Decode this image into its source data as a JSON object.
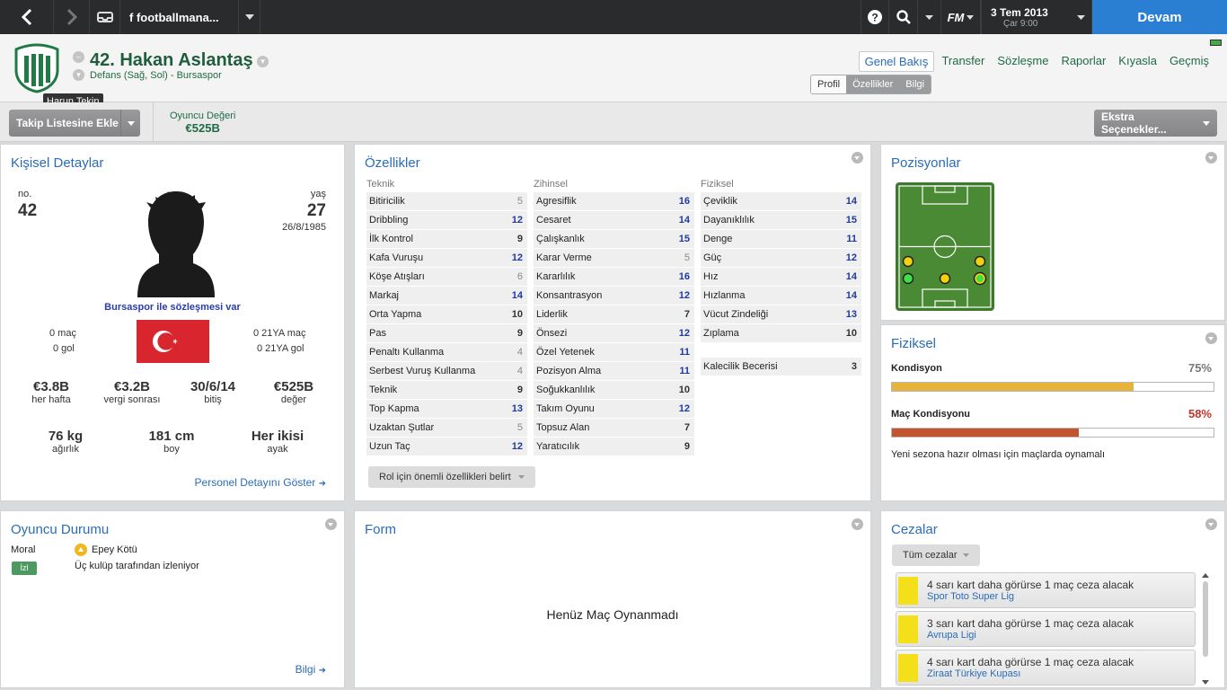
{
  "topbar": {
    "tab_title": "f footballmana...",
    "date": "3 Tem 2013",
    "day_time": "Çar 9:00",
    "fm_label": "FM",
    "continue_label": "Devam"
  },
  "player": {
    "name": "42. Hakan Aslantaş",
    "subtitle": "Defans (Sağ, Sol) - Bursaspor",
    "tooltip": "Harun Tekin"
  },
  "tabs": [
    "Genel Bakış",
    "Transfer",
    "Sözleşme",
    "Raporlar",
    "Kıyasla",
    "Geçmiş"
  ],
  "subtabs": [
    "Profil",
    "Özellikler",
    "Bilgi"
  ],
  "actions": {
    "shortlist": "Takip Listesine Ekle",
    "value_label": "Oyuncu Değeri",
    "value": "€525B",
    "extra": "Ekstra Seçenekler..."
  },
  "personal": {
    "title": "Kişisel Detaylar",
    "no_label": "no.",
    "no": "42",
    "age_label": "yaş",
    "age": "27",
    "dob": "26/8/1985",
    "contract": "Bursaspor ile sözleşmesi var",
    "apps": "0 maç",
    "goals": "0 gol",
    "u21_apps": "0 21YA maç",
    "u21_goals": "0 21YA gol",
    "stats": [
      {
        "value": "€3.8B",
        "label": "her hafta"
      },
      {
        "value": "€3.2B",
        "label": "vergi sonrası"
      },
      {
        "value": "30/6/14",
        "label": "bitiş"
      },
      {
        "value": "€525B",
        "label": "değer"
      }
    ],
    "physical": [
      {
        "value": "76 kg",
        "label": "ağırlık"
      },
      {
        "value": "181 cm",
        "label": "boy"
      },
      {
        "value": "Her ikisi",
        "label": "ayak"
      }
    ],
    "more_link": "Personel Detayını Göster"
  },
  "attributes": {
    "title": "Özellikler",
    "technical_head": "Teknik",
    "mental_head": "Zihinsel",
    "physical_head": "Fiziksel",
    "technical": [
      [
        "Bitiricilik",
        "5"
      ],
      [
        "Dribbling",
        "12"
      ],
      [
        "İlk Kontrol",
        "9"
      ],
      [
        "Kafa Vuruşu",
        "12"
      ],
      [
        "Köşe Atışları",
        "6"
      ],
      [
        "Markaj",
        "14"
      ],
      [
        "Orta Yapma",
        "10"
      ],
      [
        "Pas",
        "9"
      ],
      [
        "Penaltı Kullanma",
        "4"
      ],
      [
        "Serbest Vuruş Kullanma",
        "4"
      ],
      [
        "Teknik",
        "9"
      ],
      [
        "Top Kapma",
        "13"
      ],
      [
        "Uzaktan Şutlar",
        "5"
      ],
      [
        "Uzun Taç",
        "12"
      ]
    ],
    "mental": [
      [
        "Agresiflik",
        "16"
      ],
      [
        "Cesaret",
        "14"
      ],
      [
        "Çalışkanlık",
        "15"
      ],
      [
        "Karar Verme",
        "5"
      ],
      [
        "Kararlılık",
        "16"
      ],
      [
        "Konsantrasyon",
        "12"
      ],
      [
        "Liderlik",
        "7"
      ],
      [
        "Önsezi",
        "12"
      ],
      [
        "Özel Yetenek",
        "11"
      ],
      [
        "Pozisyon Alma",
        "11"
      ],
      [
        "Soğukkanlılık",
        "10"
      ],
      [
        "Takım Oyunu",
        "12"
      ],
      [
        "Topsuz Alan",
        "7"
      ],
      [
        "Yaratıcılık",
        "9"
      ]
    ],
    "physical": [
      [
        "Çeviklik",
        "14"
      ],
      [
        "Dayanıklılık",
        "15"
      ],
      [
        "Denge",
        "11"
      ],
      [
        "Güç",
        "12"
      ],
      [
        "Hız",
        "14"
      ],
      [
        "Hızlanma",
        "14"
      ],
      [
        "Vücut Zindeliği",
        "13"
      ],
      [
        "Zıplama",
        "10"
      ]
    ],
    "goalkeeping": [
      "Kalecilik Becerisi",
      "3"
    ],
    "role_button": "Rol için önemli özellikleri belirt"
  },
  "positions": {
    "title": "Pozisyonlar"
  },
  "fitness": {
    "title": "Fiziksel",
    "condition_label": "Kondisyon",
    "condition_value": "75%",
    "condition_pct": 75,
    "match_label": "Maç Kondisyonu",
    "match_value": "58%",
    "match_pct": 58,
    "note": "Yeni sezona hazır olması için maçlarda oynamalı",
    "condition_color": "#e8b33a",
    "match_color": "#c4542f"
  },
  "status": {
    "title": "Oyuncu Durumu",
    "morale_label": "Moral",
    "morale_value": "Epey Kötü",
    "scout_badge": "İzl",
    "scout_text": "Üç kulüp tarafından izleniyor",
    "info_link": "Bilgi"
  },
  "form": {
    "title": "Form",
    "empty": "Henüz Maç Oynanmadı"
  },
  "bans": {
    "title": "Cezalar",
    "filter": "Tüm cezalar",
    "items": [
      {
        "text": "4 sarı kart daha görürse 1 maç ceza alacak",
        "comp": "Spor Toto Super Lig"
      },
      {
        "text": "3 sarı kart daha görürse 1 maç ceza alacak",
        "comp": "Avrupa Ligi"
      },
      {
        "text": "4 sarı kart daha görürse 1 maç ceza alacak",
        "comp": "Ziraat Türkiye Kupası"
      }
    ]
  }
}
